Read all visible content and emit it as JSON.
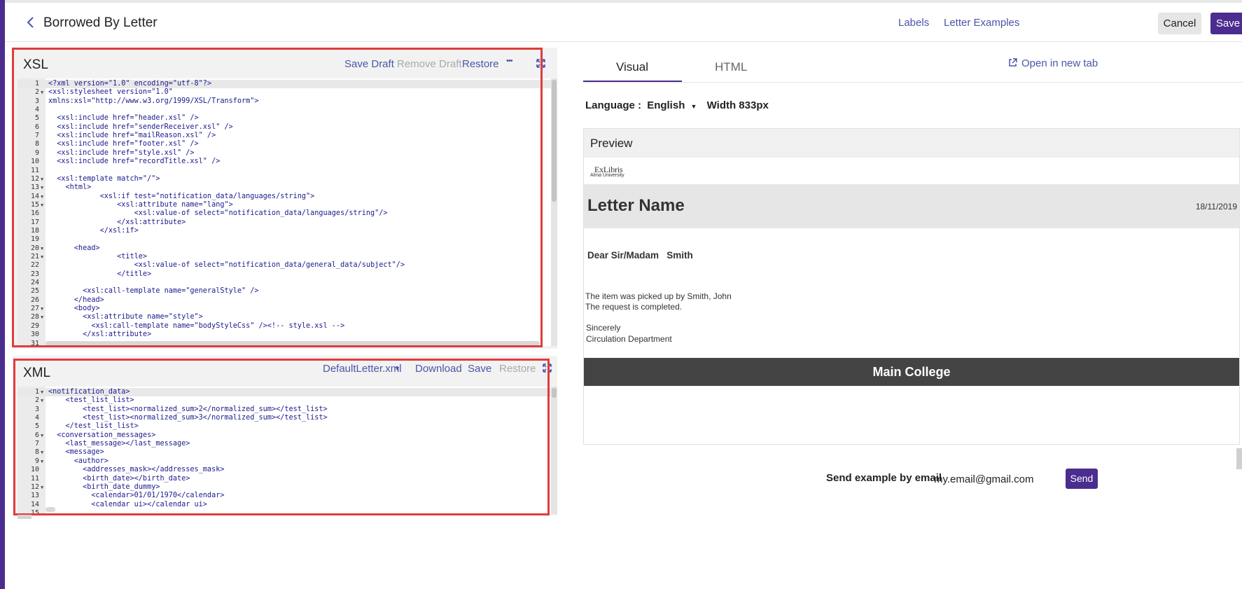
{
  "header": {
    "title": "Borrowed By Letter",
    "links": {
      "labels": "Labels",
      "examples": "Letter Examples"
    },
    "cancel": "Cancel",
    "save": "Save"
  },
  "xsl_panel": {
    "title": "XSL",
    "tools": {
      "save_draft": "Save Draft",
      "remove_draft": "Remove Draft",
      "restore": "Restore",
      "more": "•••"
    },
    "lines": [
      {
        "n": "1",
        "fold": false,
        "code": "<?xml version=\"1.0\" encoding=\"utf-8\"?>"
      },
      {
        "n": "2",
        "fold": true,
        "code": "<xsl:stylesheet version=\"1.0\""
      },
      {
        "n": "3",
        "fold": false,
        "code": "xmlns:xsl=\"http://www.w3.org/1999/XSL/Transform\">"
      },
      {
        "n": "4",
        "fold": false,
        "code": ""
      },
      {
        "n": "5",
        "fold": false,
        "code": "  <xsl:include href=\"header.xsl\" />"
      },
      {
        "n": "6",
        "fold": false,
        "code": "  <xsl:include href=\"senderReceiver.xsl\" />"
      },
      {
        "n": "7",
        "fold": false,
        "code": "  <xsl:include href=\"mailReason.xsl\" />"
      },
      {
        "n": "8",
        "fold": false,
        "code": "  <xsl:include href=\"footer.xsl\" />"
      },
      {
        "n": "9",
        "fold": false,
        "code": "  <xsl:include href=\"style.xsl\" />"
      },
      {
        "n": "10",
        "fold": false,
        "code": "  <xsl:include href=\"recordTitle.xsl\" />"
      },
      {
        "n": "11",
        "fold": false,
        "code": ""
      },
      {
        "n": "12",
        "fold": true,
        "code": "  <xsl:template match=\"/\">"
      },
      {
        "n": "13",
        "fold": true,
        "code": "    <html>"
      },
      {
        "n": "14",
        "fold": true,
        "code": "            <xsl:if test=\"notification_data/languages/string\">"
      },
      {
        "n": "15",
        "fold": true,
        "code": "                <xsl:attribute name=\"lang\">"
      },
      {
        "n": "16",
        "fold": false,
        "code": "                    <xsl:value-of select=\"notification_data/languages/string\"/>"
      },
      {
        "n": "17",
        "fold": false,
        "code": "                </xsl:attribute>"
      },
      {
        "n": "18",
        "fold": false,
        "code": "            </xsl:if>"
      },
      {
        "n": "19",
        "fold": false,
        "code": ""
      },
      {
        "n": "20",
        "fold": true,
        "code": "      <head>"
      },
      {
        "n": "21",
        "fold": true,
        "code": "                <title>"
      },
      {
        "n": "22",
        "fold": false,
        "code": "                    <xsl:value-of select=\"notification_data/general_data/subject\"/>"
      },
      {
        "n": "23",
        "fold": false,
        "code": "                </title>"
      },
      {
        "n": "24",
        "fold": false,
        "code": ""
      },
      {
        "n": "25",
        "fold": false,
        "code": "        <xsl:call-template name=\"generalStyle\" />"
      },
      {
        "n": "26",
        "fold": false,
        "code": "      </head>"
      },
      {
        "n": "27",
        "fold": true,
        "code": "      <body>"
      },
      {
        "n": "28",
        "fold": true,
        "code": "        <xsl:attribute name=\"style\">"
      },
      {
        "n": "29",
        "fold": false,
        "code": "          <xsl:call-template name=\"bodyStyleCss\" /><!-- style.xsl -->"
      },
      {
        "n": "30",
        "fold": false,
        "code": "        </xsl:attribute>"
      },
      {
        "n": "31",
        "fold": false,
        "code": ""
      }
    ]
  },
  "xml_panel": {
    "title": "XML",
    "tools": {
      "file": "DefaultLetter.xml",
      "download": "Download",
      "save": "Save",
      "restore": "Restore"
    },
    "lines": [
      {
        "n": "1",
        "fold": true,
        "code": "<notification_data>"
      },
      {
        "n": "2",
        "fold": true,
        "code": "    <test_list_list>"
      },
      {
        "n": "3",
        "fold": false,
        "code": "        <test_list><normalized_sum>2</normalized_sum></test_list>"
      },
      {
        "n": "4",
        "fold": false,
        "code": "        <test_list><normalized_sum>3</normalized_sum></test_list>"
      },
      {
        "n": "5",
        "fold": false,
        "code": "    </test_list_list>"
      },
      {
        "n": "6",
        "fold": true,
        "code": "  <conversation_messages>"
      },
      {
        "n": "7",
        "fold": false,
        "code": "    <last_message></last_message>"
      },
      {
        "n": "8",
        "fold": true,
        "code": "    <message>"
      },
      {
        "n": "9",
        "fold": true,
        "code": "      <author>"
      },
      {
        "n": "10",
        "fold": false,
        "code": "        <addresses_mask></addresses_mask>"
      },
      {
        "n": "11",
        "fold": false,
        "code": "        <birth_date></birth_date>"
      },
      {
        "n": "12",
        "fold": true,
        "code": "        <birth_date_dummy>"
      },
      {
        "n": "13",
        "fold": false,
        "code": "          <calendar>01/01/1970</calendar>"
      },
      {
        "n": "14",
        "fold": false,
        "code": "          <calendar ui></calendar ui>"
      },
      {
        "n": "15",
        "fold": false,
        "code": ""
      }
    ]
  },
  "tabs": {
    "visual": "Visual",
    "html": "HTML"
  },
  "open_new_tab": "Open in new tab",
  "language": {
    "label": "Language :",
    "value": "English",
    "width": "Width 833px"
  },
  "preview": {
    "title": "Preview",
    "logo_text": "ExLibris",
    "logo_sub": "Alma University",
    "letter_name": "Letter Name",
    "date": "18/11/2019",
    "dear": "Dear Sir/Madam   Smith",
    "body": [
      "The item was picked up by Smith, John",
      "The request is completed.",
      "",
      "Sincerely",
      "Circulation Department"
    ],
    "footer": "Main College"
  },
  "send": {
    "label": "Send example by email",
    "email": "my.email@gmail.com",
    "button": "Send"
  },
  "colors": {
    "accent": "#4b2c8f",
    "link": "#4a56a8",
    "frame": "#e03c3c"
  }
}
